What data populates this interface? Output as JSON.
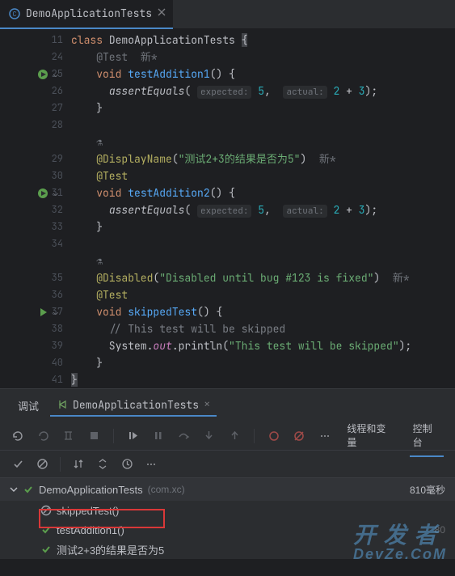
{
  "tab": {
    "title": "DemoApplicationTests"
  },
  "editor": {
    "lines": [
      {
        "n": "11",
        "icon": null,
        "chev": false,
        "type": "class-decl"
      },
      {
        "n": "24",
        "icon": null,
        "chev": false,
        "type": "test-annot-phantom"
      },
      {
        "n": "25",
        "icon": "run-green",
        "chev": true,
        "type": "method1-sig"
      },
      {
        "n": "26",
        "icon": null,
        "chev": false,
        "type": "assert-line"
      },
      {
        "n": "27",
        "icon": null,
        "chev": false,
        "type": "brace-close-2"
      },
      {
        "n": "28",
        "icon": null,
        "chev": false,
        "type": "blank"
      },
      {
        "n": "",
        "icon": null,
        "chev": false,
        "type": "author-hint"
      },
      {
        "n": "29",
        "icon": null,
        "chev": false,
        "type": "display-name"
      },
      {
        "n": "30",
        "icon": null,
        "chev": false,
        "type": "test-annot"
      },
      {
        "n": "31",
        "icon": "run-green",
        "chev": true,
        "type": "method2-sig"
      },
      {
        "n": "32",
        "icon": null,
        "chev": false,
        "type": "assert-line"
      },
      {
        "n": "33",
        "icon": null,
        "chev": false,
        "type": "brace-close-2"
      },
      {
        "n": "34",
        "icon": null,
        "chev": false,
        "type": "blank"
      },
      {
        "n": "",
        "icon": null,
        "chev": false,
        "type": "author-hint"
      },
      {
        "n": "35",
        "icon": null,
        "chev": false,
        "type": "disabled-annot"
      },
      {
        "n": "36",
        "icon": null,
        "chev": false,
        "type": "test-annot"
      },
      {
        "n": "37",
        "icon": "run-play",
        "chev": true,
        "type": "method3-sig"
      },
      {
        "n": "38",
        "icon": null,
        "chev": false,
        "type": "comment-line"
      },
      {
        "n": "39",
        "icon": null,
        "chev": false,
        "type": "println-line"
      },
      {
        "n": "40",
        "icon": null,
        "chev": false,
        "type": "brace-close-2"
      },
      {
        "n": "41",
        "icon": null,
        "chev": false,
        "type": "brace-close-1"
      }
    ],
    "tokens": {
      "class_kw": "class",
      "class_name": "DemoApplicationTests",
      "test_annot": "@Test",
      "void_kw": "void",
      "method1": "testAddition1",
      "method2": "testAddition2",
      "method3": "skippedTest",
      "assert_call": "assertEquals",
      "expected_hint": "expected:",
      "actual_hint": "actual:",
      "expected_val": "5",
      "actual_lhs": "2",
      "actual_op": " + ",
      "actual_rhs": "3",
      "new_marker": "新*",
      "display_annot": "@DisplayName",
      "display_str": "\"测试2+3的结果是否为5\"",
      "disabled_annot": "@Disabled",
      "disabled_str": "\"Disabled until bug #123 is fixed\"",
      "comment": "// This test will be skipped",
      "println_sys": "System",
      "println_out": "out",
      "println_m": "println",
      "println_str": "\"This test will be skipped\""
    }
  },
  "panel": {
    "debug_label": "调试",
    "run_config": "DemoApplicationTests",
    "right_tabs": {
      "threads": "线程和变量",
      "console": "控制台"
    }
  },
  "tree": {
    "root": "DemoApplicationTests",
    "pkg": "(com.xc)",
    "root_time": "810毫秒",
    "items": [
      {
        "status": "skipped",
        "label": "skippedTest()",
        "time": ""
      },
      {
        "status": "passed",
        "label": "testAddition1()",
        "time": "80"
      },
      {
        "status": "passed",
        "label": "测试2+3的结果是否为5",
        "time": ""
      }
    ]
  },
  "watermark": {
    "line1": "开 发 者",
    "line2": "DevZe.CoM"
  }
}
